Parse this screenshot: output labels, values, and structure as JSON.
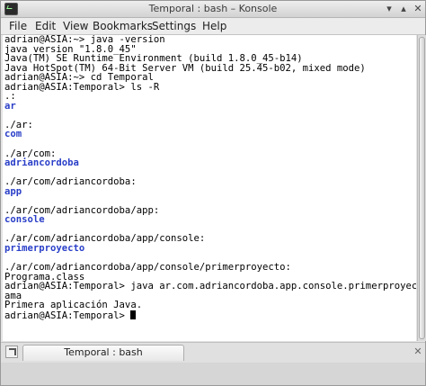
{
  "window": {
    "title": "Temporal : bash – Konsole",
    "minimize_glyph": "▾",
    "maximize_glyph": "▴",
    "close_glyph": "✕"
  },
  "menubar": {
    "items": [
      "File",
      "Edit",
      "View",
      "Bookmarks",
      "Settings",
      "Help"
    ]
  },
  "terminal": {
    "lines": [
      {
        "text": "adrian@ASIA:~> java -version",
        "dir": false
      },
      {
        "text": "java version \"1.8.0_45\"",
        "dir": false
      },
      {
        "text": "Java(TM) SE Runtime Environment (build 1.8.0_45-b14)",
        "dir": false
      },
      {
        "text": "Java HotSpot(TM) 64-Bit Server VM (build 25.45-b02, mixed mode)",
        "dir": false
      },
      {
        "text": "adrian@ASIA:~> cd Temporal",
        "dir": false
      },
      {
        "text": "adrian@ASIA:Temporal> ls -R",
        "dir": false
      },
      {
        "text": ".:",
        "dir": false
      },
      {
        "text": "ar",
        "dir": true
      },
      {
        "text": "",
        "dir": false
      },
      {
        "text": "./ar:",
        "dir": false
      },
      {
        "text": "com",
        "dir": true
      },
      {
        "text": "",
        "dir": false
      },
      {
        "text": "./ar/com:",
        "dir": false
      },
      {
        "text": "adriancordoba",
        "dir": true
      },
      {
        "text": "",
        "dir": false
      },
      {
        "text": "./ar/com/adriancordoba:",
        "dir": false
      },
      {
        "text": "app",
        "dir": true
      },
      {
        "text": "",
        "dir": false
      },
      {
        "text": "./ar/com/adriancordoba/app:",
        "dir": false
      },
      {
        "text": "console",
        "dir": true
      },
      {
        "text": "",
        "dir": false
      },
      {
        "text": "./ar/com/adriancordoba/app/console:",
        "dir": false
      },
      {
        "text": "primerproyecto",
        "dir": true
      },
      {
        "text": "",
        "dir": false
      },
      {
        "text": "./ar/com/adriancordoba/app/console/primerproyecto:",
        "dir": false
      },
      {
        "text": "Programa.class",
        "dir": false
      },
      {
        "text": "adrian@ASIA:Temporal> java ar.com.adriancordoba.app.console.primerproyecto.Progr",
        "dir": false
      },
      {
        "text": "ama",
        "dir": false
      },
      {
        "text": "Primera aplicación Java.",
        "dir": false
      }
    ],
    "prompt": "adrian@ASIA:Temporal> ",
    "colors": {
      "background": "#ffffff",
      "foreground": "#000000",
      "directory": "#2a3fc8"
    }
  },
  "tabbar": {
    "tab_label": "Temporal : bash",
    "close_glyph": "✕"
  }
}
